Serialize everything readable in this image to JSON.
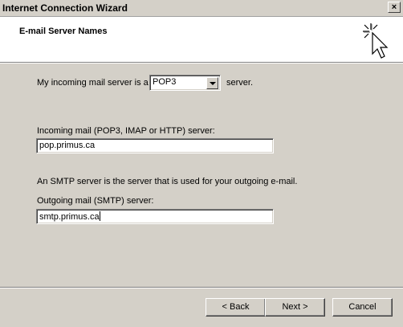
{
  "window": {
    "title": "Internet Connection Wizard",
    "close_glyph": "×"
  },
  "header": {
    "title": "E-mail Server Names",
    "icon": "wizard-cursor-icon"
  },
  "form": {
    "incoming_type_prefix": "My incoming mail server is a",
    "incoming_type_value": "POP3",
    "incoming_type_suffix": "server.",
    "incoming_label": "Incoming mail (POP3, IMAP or HTTP) server:",
    "incoming_value": "pop.primus.ca",
    "smtp_note": "An SMTP server is the server that is used for your outgoing e-mail.",
    "outgoing_label": "Outgoing mail (SMTP) server:",
    "outgoing_value": "smtp.primus.ca"
  },
  "buttons": {
    "back": "< Back",
    "next": "Next >",
    "cancel": "Cancel"
  }
}
